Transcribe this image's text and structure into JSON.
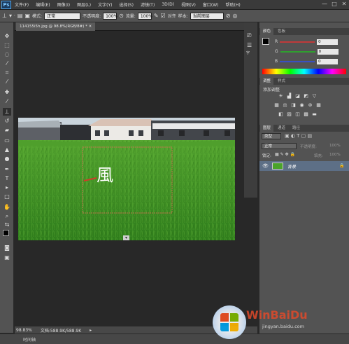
{
  "app": {
    "logo": "Ps"
  },
  "menu": [
    "文件(F)",
    "编辑(E)",
    "图像(I)",
    "图层(L)",
    "文字(Y)",
    "选择(S)",
    "滤镜(T)",
    "3D(D)",
    "视图(V)",
    "窗口(W)",
    "帮助(H)"
  ],
  "window_controls": [
    "—",
    "□",
    "✕"
  ],
  "options": {
    "mode_label": "模式:",
    "mode_value": "正常",
    "opacity_label": "不透明度:",
    "opacity_value": "100%",
    "flow_label": "流量:",
    "flow_value": "100%",
    "aligned_label": "对齐",
    "sample_label": "样本:",
    "sample_value": "当前图层"
  },
  "document": {
    "tab_label": "114155i5h.jpg @ 98.8%(RGB/8#) *",
    "overlay_char": "風"
  },
  "status": {
    "zoom": "98.83%",
    "doc_info": "文档:588.9K/588.9K"
  },
  "timeline_label": "时间轴",
  "color_panel": {
    "tabs": [
      "颜色",
      "色板"
    ],
    "rows": [
      {
        "label": "R",
        "value": "0",
        "color": "#e03a3a"
      },
      {
        "label": "G",
        "value": "0",
        "color": "#2fbf2f"
      },
      {
        "label": "B",
        "value": "0",
        "color": "#3a5ae0"
      }
    ]
  },
  "adjust_panel": {
    "tabs": [
      "调整",
      "样式"
    ],
    "title": "添加调整"
  },
  "layers_panel": {
    "tabs": [
      "图层",
      "通道",
      "路径"
    ],
    "kind_label": "类型",
    "blend_value": "正常",
    "opacity_label": "不透明度:",
    "opacity_value": "100%",
    "lock_label": "锁定:",
    "fill_label": "填充:",
    "fill_value": "100%",
    "layer_name": "背景"
  },
  "watermark": {
    "text1": "WinBaiDu",
    "text2": "jingyan.baidu.com"
  }
}
